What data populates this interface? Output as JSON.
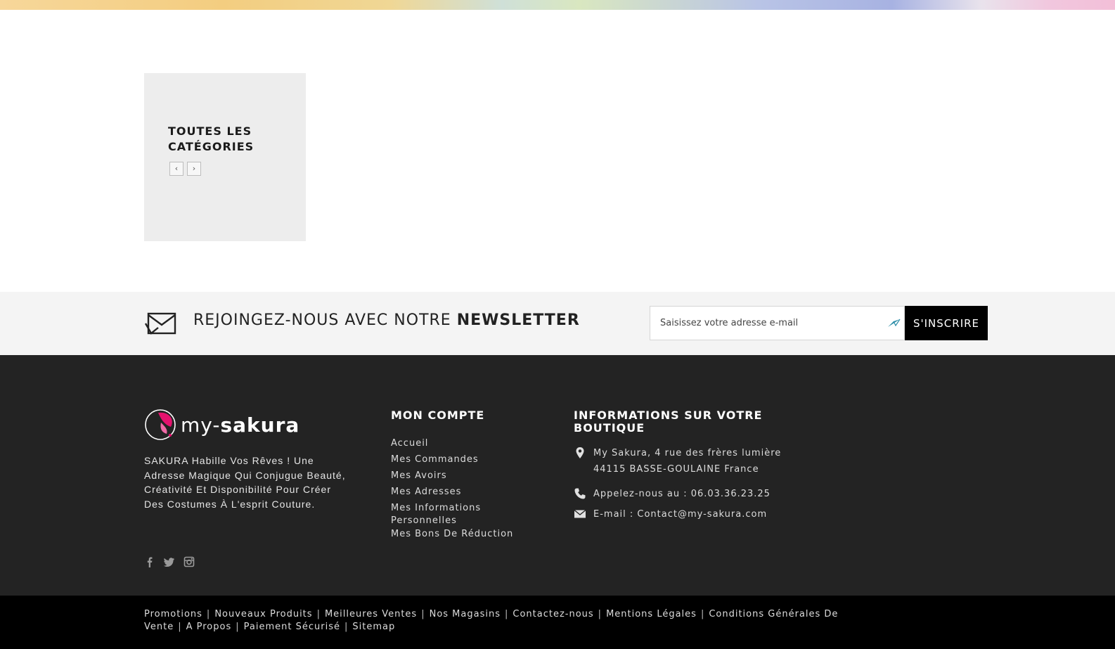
{
  "categories": {
    "title": "Toutes les catégories",
    "prev_icon": "‹",
    "next_icon": "›"
  },
  "newsletter": {
    "heading_prefix": "REJOINGEZ-NOUS AVEC NOTRE ",
    "heading_bold": "NEWSLETTER",
    "input_placeholder": "Saisissez votre adresse e-mail",
    "button_label": "S'INSCRIRE",
    "icon": "envelope-icon"
  },
  "footer": {
    "logo": {
      "light": "my-",
      "bold": "sakura",
      "accent_color": "#e5126e"
    },
    "about_text": "SAKURA Habille Vos Rêves ! Une Adresse Magique Qui Conjugue Beauté, Créativité Et Disponibilité Pour Créer Des Costumes À L'esprit Couture.",
    "social_icons": [
      "facebook-icon",
      "twitter-icon",
      "instagram-icon"
    ],
    "account": {
      "title": "Mon compte",
      "links": [
        "Accueil",
        "Mes Commandes",
        "Mes Avoirs",
        "Mes Adresses",
        "Mes Informations Personnelles",
        "Mes Bons De Réduction"
      ]
    },
    "store": {
      "title": "Informations sur votre boutique",
      "address_line1": "My Sakura, 4 rue des frères lumière",
      "address_line2": "44115 BASSE-GOULAINE France",
      "phone": "Appelez-nous au : 06.03.36.23.25",
      "email": "E-mail : Contact@my-sakura.com"
    }
  },
  "bottom_links": [
    "Promotions",
    "Nouveaux Produits",
    "Meilleures Ventes",
    "Nos Magasins",
    "Contactez-nous",
    "Mentions Légales",
    "Conditions Générales De Vente",
    "A Propos",
    "Paiement Sécurisé",
    "Sitemap"
  ]
}
